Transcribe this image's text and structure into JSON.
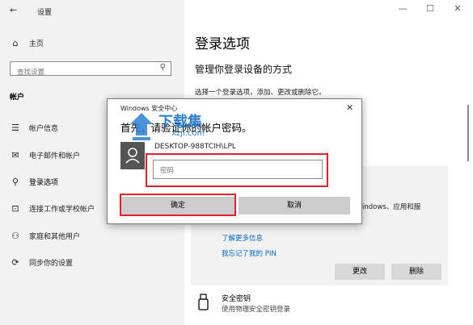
{
  "window": {
    "back_glyph": "←",
    "title": "设置",
    "controls": [
      "—",
      "☐",
      "✕"
    ]
  },
  "sidebar": {
    "home_label": "主页",
    "search_placeholder": "查找设置",
    "section_title": "帐户",
    "items": [
      {
        "label": "帐户信息",
        "icon": "person-card-icon",
        "glyph": "☰"
      },
      {
        "label": "电子邮件和帐户",
        "icon": "mail-icon",
        "glyph": "✉"
      },
      {
        "label": "登录选项",
        "icon": "key-icon",
        "glyph": "⚲"
      },
      {
        "label": "连接工作或学校帐户",
        "icon": "briefcase-icon",
        "glyph": "⊡"
      },
      {
        "label": "家庭和其他用户",
        "icon": "people-icon",
        "glyph": "⚇"
      },
      {
        "label": "同步你的设置",
        "icon": "sync-icon",
        "glyph": "⟳"
      }
    ]
  },
  "main": {
    "title": "登录选项",
    "subtitle": "管理你登录设备的方式",
    "description": "选择一个登录选项，添加、更改或删除它。",
    "partial_text": "indows、应用和服",
    "learn_more": "了解更多信息",
    "forgot_pin": "我忘记了我的 PIN",
    "change_button": "更改",
    "delete_button": "删除",
    "security_key_title": "安全密钥",
    "security_key_desc": "使用物理安全密钥登录"
  },
  "dialog": {
    "title": "Windows 安全中心",
    "heading": "首先，请验证你的帐户密码。",
    "account": "DESKTOP-988TCIH\\LPL",
    "password_placeholder": "密码",
    "ok_label": "确定",
    "cancel_label": "取消",
    "close_glyph": "✕"
  },
  "watermark": {
    "text": "下载集",
    "subtext": "xzji.com"
  },
  "colors": {
    "highlight_red": "#e0202a",
    "sidebar_bg": "#f2f2f2",
    "link_blue": "#0067c0"
  }
}
